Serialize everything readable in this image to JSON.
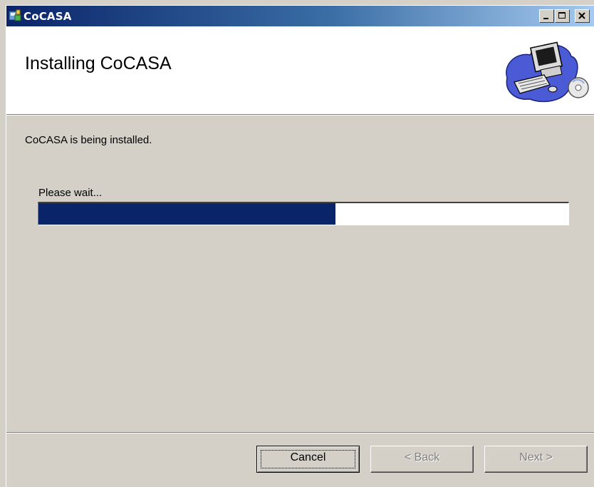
{
  "window": {
    "title": "CoCASA",
    "icons": {
      "app": "installer-icon",
      "minimize": "minimize-icon",
      "maximize": "maximize-icon",
      "close": "close-icon"
    }
  },
  "banner": {
    "title": "Installing CoCASA",
    "art": "computer-with-cd-icon"
  },
  "body": {
    "status": "CoCASA is being installed.",
    "wait_label": "Please wait...",
    "progress": 0.56
  },
  "buttons": {
    "cancel": "Cancel",
    "back": "< Back",
    "next": "Next >"
  },
  "colors": {
    "titlebar_start": "#0a246a",
    "progress_fill": "#0a246a",
    "dialog_bg": "#d4d0c8"
  }
}
